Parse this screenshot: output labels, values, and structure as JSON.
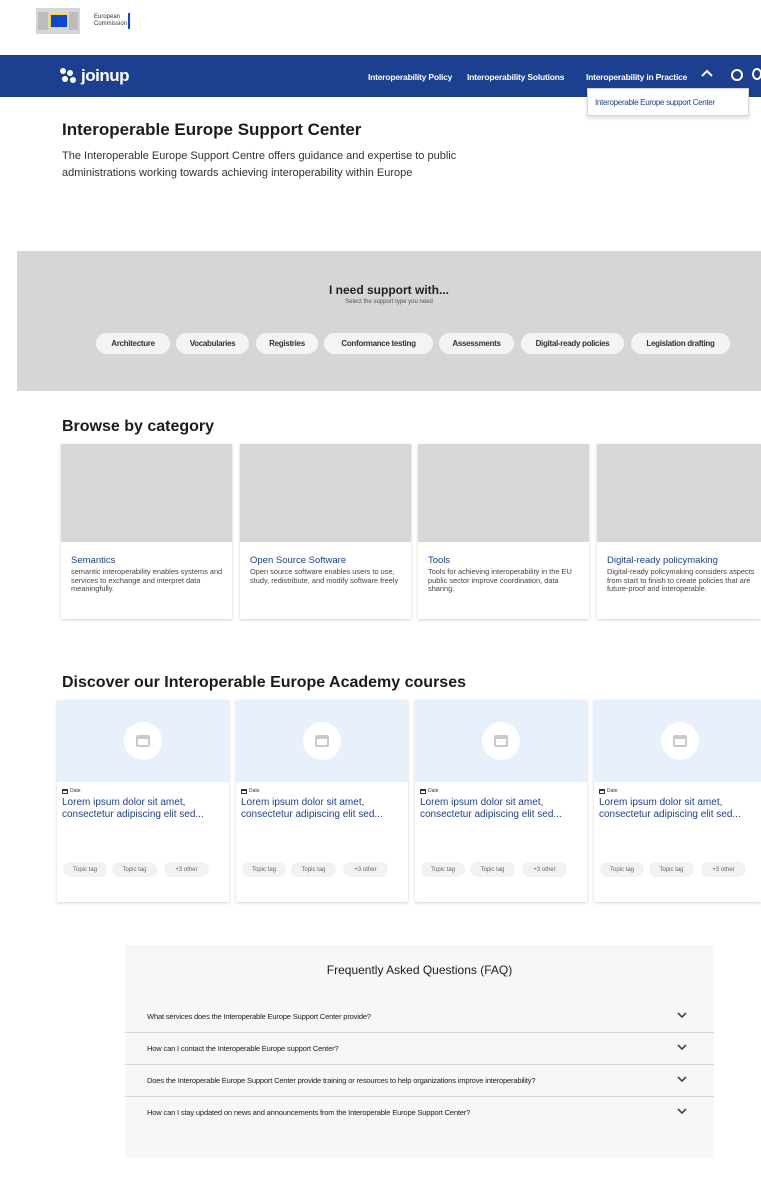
{
  "ec_header": {
    "logo_text_line1": "European",
    "logo_text_line2": "Commission"
  },
  "nav": {
    "brand": "joinup",
    "items": [
      {
        "label": "Interoperability Policy"
      },
      {
        "label": "Interoperability Solutions"
      },
      {
        "label": "Interoperability in Practice"
      }
    ],
    "dropdown_item": "Interoperable Europe support Center",
    "colors": {
      "nav_bg": "#1d3f8f",
      "accent": "#3a74d6"
    }
  },
  "hero": {
    "title": "Interoperable Europe Support Center",
    "description": "The Interoperable Europe Support Centre offers guidance and expertise to public administrations working towards achieving interoperability within Europe"
  },
  "support": {
    "title": "I need support with...",
    "subtitle": "Select the support type you need",
    "options": [
      "Architecture",
      "Vocabularies",
      "Registries",
      "Conformance testing",
      "Assessments",
      "Digital-ready policies",
      "Legislation drafting"
    ]
  },
  "browse": {
    "heading": "Browse by category",
    "categories": [
      {
        "title": "Semantics",
        "description": "semantic interoperability enables systems and services to exchange and interpret data meaningfully."
      },
      {
        "title": "Open Source Software",
        "description": "Open source software enables users to use, study, redistribute, and modify software freely"
      },
      {
        "title": "Tools",
        "description": "Tools for achieving interoperability in the EU public sector improve coordination, data sharing."
      },
      {
        "title": "Digital-ready policymaking",
        "description": "Digital-ready policymaking considers aspects from start to finish to create policies that are future-proof and interoperable."
      }
    ]
  },
  "courses": {
    "heading": "Discover our Interoperable Europe Academy courses",
    "prev_arrow": "←",
    "next_arrow": "→",
    "items": [
      {
        "date": "Date",
        "title": "Lorem ipsum dolor sit amet, consectetur adipiscing elit sed...",
        "tags": [
          "Topic tag",
          "Topic tag",
          "+3 other"
        ]
      },
      {
        "date": "Date",
        "title": "Lorem ipsum dolor sit amet, consectetur adipiscing elit sed...",
        "tags": [
          "Topic tag",
          "Topic tag",
          "+3 other"
        ]
      },
      {
        "date": "Date",
        "title": "Lorem ipsum dolor sit amet, consectetur adipiscing elit sed...",
        "tags": [
          "Topic tag",
          "Topic tag",
          "+3 other"
        ]
      },
      {
        "date": "Date",
        "title": "Lorem ipsum dolor sit amet, consectetur adipiscing elit sed...",
        "tags": [
          "Topic tag",
          "Topic tag",
          "+3 other"
        ]
      }
    ]
  },
  "faq": {
    "title": "Frequently Asked Questions (FAQ)",
    "questions": [
      "What services does the Interoperable Europe Support Center provide?",
      "How can I contact the Interoperable Europe support Center?",
      "Does the Interoperable Europe Support Center provide training or resources to help organizations improve interoperability?",
      "How can I stay updated on news and announcements from the Interoperable Europe Support Center?"
    ]
  }
}
